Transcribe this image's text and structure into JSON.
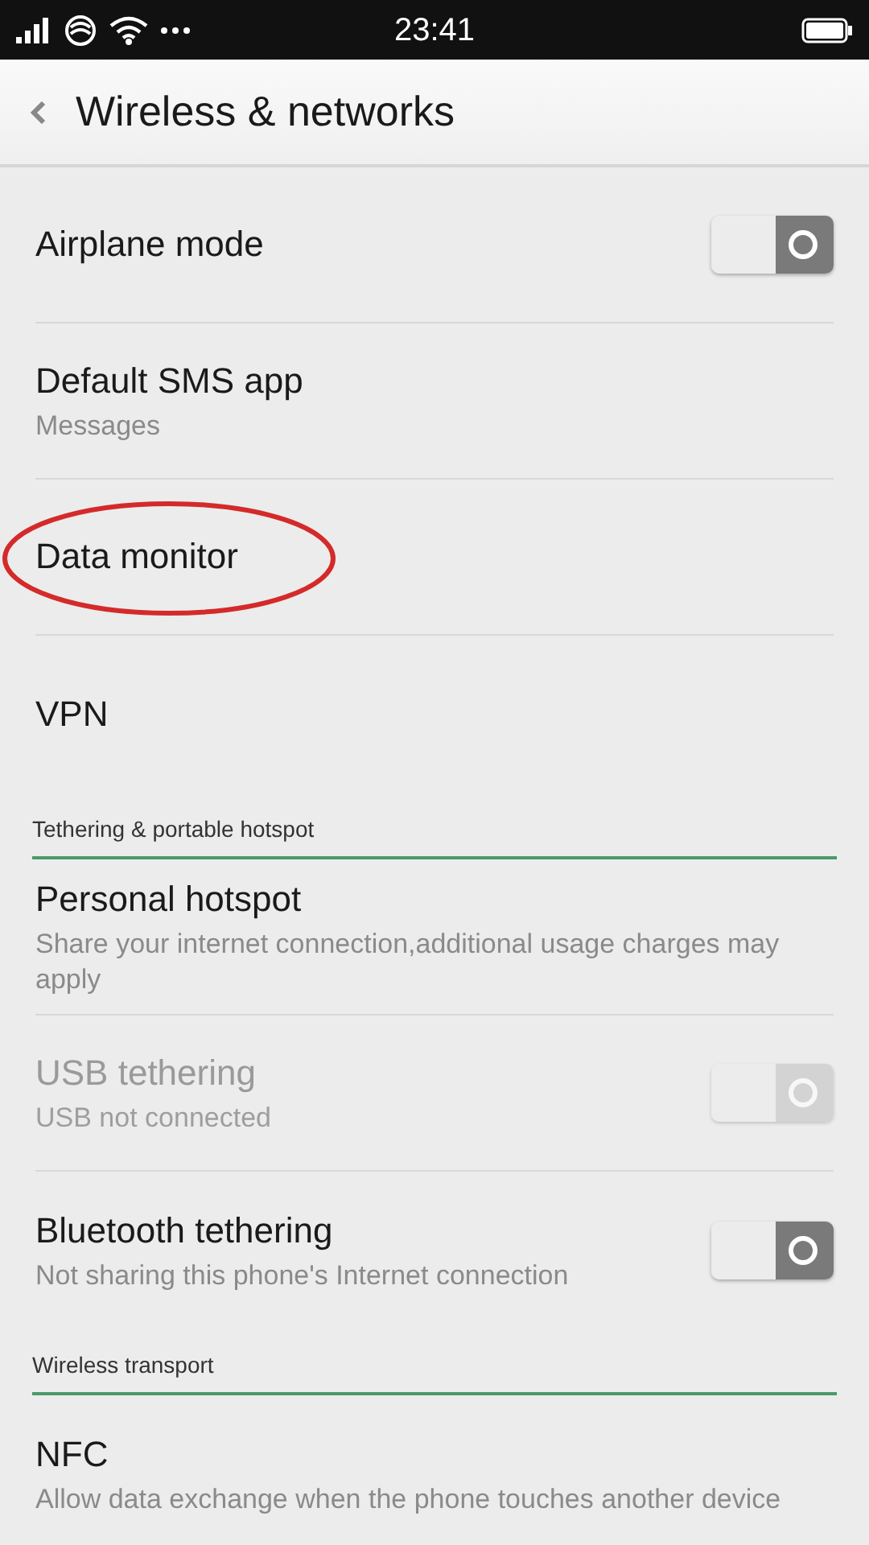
{
  "status_bar": {
    "time": "23:41"
  },
  "header": {
    "title": "Wireless & networks"
  },
  "sections": [
    {
      "items": [
        {
          "kind": "toggle",
          "title": "Airplane mode",
          "on": false,
          "disabled": false
        },
        {
          "kind": "link",
          "title": "Default SMS app",
          "subtitle": "Messages"
        },
        {
          "kind": "link",
          "title": "Data monitor",
          "circled": true
        },
        {
          "kind": "link",
          "title": "VPN"
        }
      ]
    },
    {
      "heading": "Tethering & portable hotspot",
      "items": [
        {
          "kind": "link",
          "title": "Personal hotspot",
          "subtitle": "Share your internet connection,additional usage charges may apply"
        },
        {
          "kind": "toggle",
          "title": "USB tethering",
          "subtitle": "USB not connected",
          "on": false,
          "disabled": true
        },
        {
          "kind": "toggle",
          "title": "Bluetooth tethering",
          "subtitle": "Not sharing this phone's Internet connection",
          "on": false,
          "disabled": false
        }
      ]
    },
    {
      "heading": "Wireless transport",
      "items": [
        {
          "kind": "link",
          "title": "NFC",
          "subtitle": "Allow data exchange when the phone touches another device"
        }
      ]
    }
  ]
}
